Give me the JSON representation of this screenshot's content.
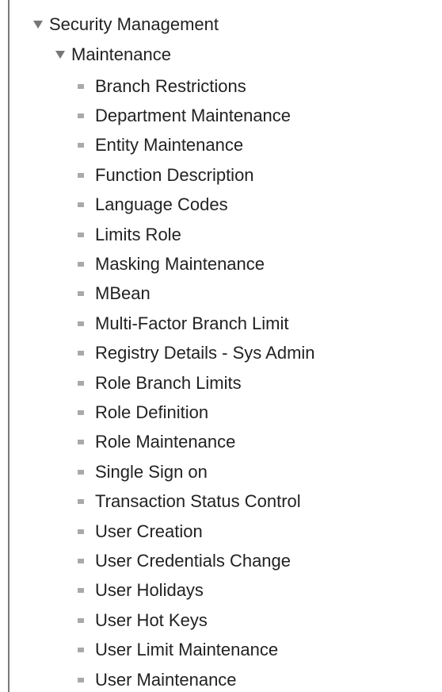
{
  "tree": {
    "root_label": "Security Management",
    "root_icon": "collapse-triangle-icon",
    "maintenance_label": "Maintenance",
    "maintenance_icon": "collapse-triangle-icon",
    "items": [
      {
        "label": "Branch Restrictions"
      },
      {
        "label": "Department Maintenance"
      },
      {
        "label": "Entity Maintenance"
      },
      {
        "label": "Function Description"
      },
      {
        "label": "Language Codes"
      },
      {
        "label": "Limits Role"
      },
      {
        "label": "Masking Maintenance"
      },
      {
        "label": "MBean"
      },
      {
        "label": "Multi-Factor Branch Limit"
      },
      {
        "label": "Registry Details - Sys Admin"
      },
      {
        "label": "Role Branch Limits"
      },
      {
        "label": "Role Definition"
      },
      {
        "label": "Role Maintenance"
      },
      {
        "label": "Single Sign on"
      },
      {
        "label": "Transaction Status Control"
      },
      {
        "label": "User Creation"
      },
      {
        "label": "User Credentials Change"
      },
      {
        "label": "User Holidays"
      },
      {
        "label": "User Hot Keys"
      },
      {
        "label": "User Limit Maintenance"
      },
      {
        "label": "User Maintenance"
      }
    ]
  },
  "colors": {
    "text": "#222222",
    "triangle": "#777777",
    "bullet": "#a9a9a9",
    "border": "#7a7a7a"
  }
}
